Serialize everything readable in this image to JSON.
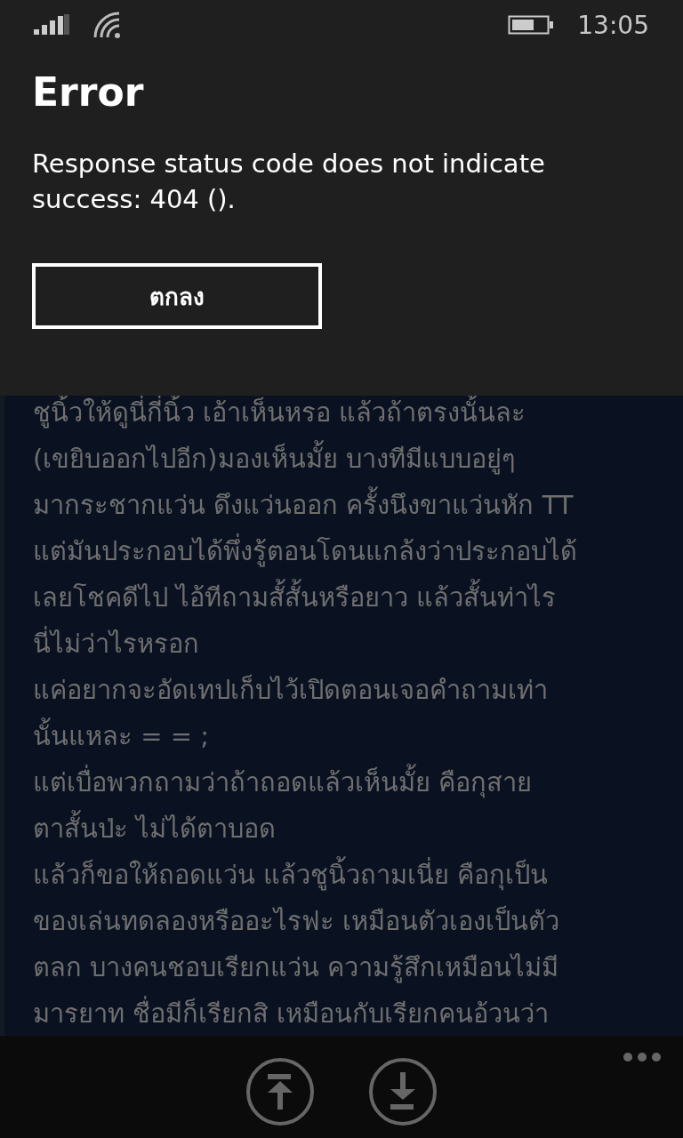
{
  "status_bar": {
    "time": "13:05"
  },
  "dialog": {
    "title": "Error",
    "message": "Response status code does not indicate success: 404 ().",
    "button": "ตกลง"
  },
  "content": {
    "lines": [
      "ชูนิ้วให้ดูนี่กี่นิ้ว เอ้าเห็นหรอ แล้วถ้าตรงนั้นละ",
      "(เขยิบออกไปอีก)มองเห็นมั้ย บางทีมีแบบอยู่ๆ",
      "มากระชากแว่น ดึงแว่นออก ครั้งนึงขาแว่นหัก TT",
      "แต่มันประกอบได้พึ่งรู้ตอนโดนแกล้งว่าประกอบได้",
      "เลยโชคดีไป ไอ้ทีถามสั้สั้นหรือยาว แล้วสั้นท่าไร",
      "นี่ไม่ว่าไรหรอก",
      "แค่อยากจะอัดเทปเก็บไว้เปิดตอนเจอคำถามเท่า",
      "นั้นแหละ = = ;",
      "แต่เบื่อพวกถามว่าถ้าถอดแล้วเห็นมั้ย คือกุสาย",
      "ตาสั้นป่ะ ไม่ได้ตาบอด",
      "แล้วก็ขอให้ถอดแว่น แล้วชูนิ้วถามเนี่ย คือกุเป็น",
      "ของเล่นทดลองหรืออะไรฟะ เหมือนตัวเองเป็นตัว",
      "ตลก บางคนชอบเรียกแว่น ความรู้สึกเหมือนไม่มี",
      "มารยาท ชื่อมีก็เรียกสิ เหมือนกับเรียกคนอ้วนว่า"
    ]
  },
  "app_bar": {
    "buttons": [
      {
        "kind": "scroll-top"
      },
      {
        "kind": "download"
      }
    ]
  }
}
